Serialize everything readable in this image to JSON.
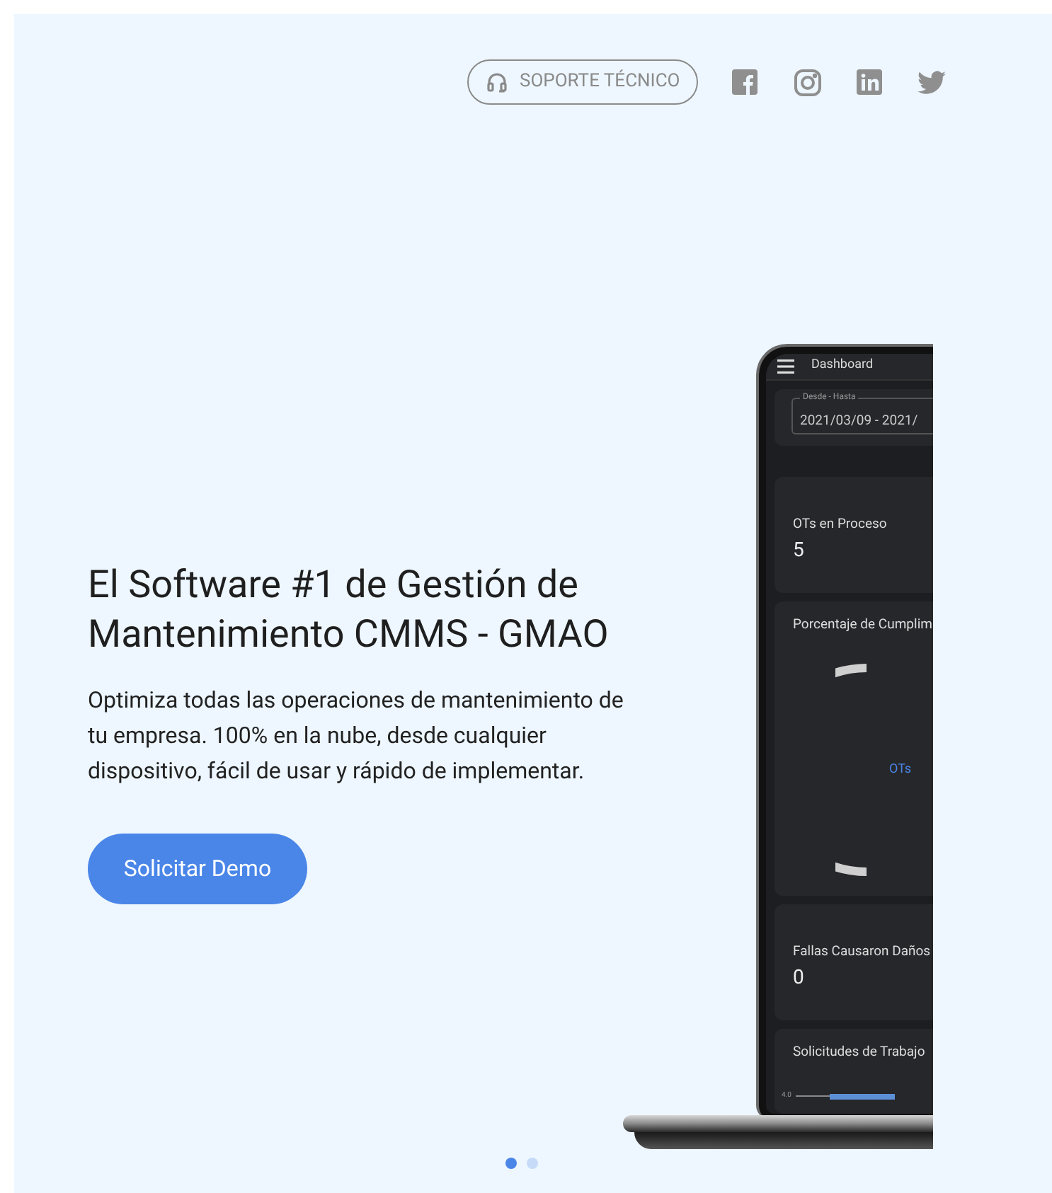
{
  "header": {
    "support_button": "SOPORTE TÉCNICO",
    "social": [
      {
        "kind": "facebook"
      },
      {
        "kind": "instagram"
      },
      {
        "kind": "linkedin"
      },
      {
        "kind": "twitter"
      }
    ]
  },
  "hero": {
    "title": "El Software #1 de Gestión de Mantenimiento CMMS - GMAO",
    "description": "Optimiza todas las operaciones de mantenimiento de tu empresa. 100% en la nube, desde cualquier dispositivo, fácil de usar y rápido de implementar.",
    "cta": "Solicitar Demo"
  },
  "device_screen": {
    "app_bar_title": "Dashboard",
    "date_field": {
      "label": "Desde - Hasta",
      "value": "2021/03/09 - 2021/"
    },
    "cards": [
      {
        "kind": "stat",
        "title": "OTs en Proceso",
        "value": "5"
      },
      {
        "kind": "donut",
        "title": "Porcentaje de Cumplim",
        "center_label": "OTs"
      },
      {
        "kind": "stat",
        "title": "Fallas Causaron Daños",
        "value": "0"
      },
      {
        "kind": "bars",
        "title": "Solicitudes de Trabajo",
        "y_tick": "4.0"
      }
    ]
  },
  "carousel": {
    "dots": [
      {
        "selected": true
      },
      {
        "selected": false
      }
    ]
  }
}
